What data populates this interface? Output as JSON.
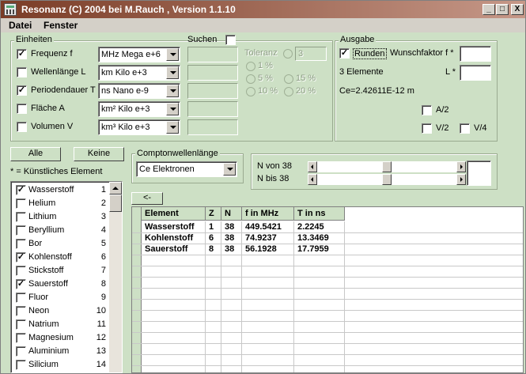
{
  "window": {
    "title": "Resonanz (C) 2004 bei M.Rauch , Version 1.1.10",
    "minimize": "_",
    "maximize": "□",
    "close": "X"
  },
  "menu": {
    "items": [
      "Datei",
      "Fenster"
    ]
  },
  "einheiten": {
    "label": "Einheiten",
    "rows": [
      {
        "checked": true,
        "label": "Frequenz f",
        "unit": "MHz Mega e+6"
      },
      {
        "checked": false,
        "label": "Wellenlänge L",
        "unit": "km Kilo e+3"
      },
      {
        "checked": true,
        "label": "Periodendauer T",
        "unit": "ns Nano e-9"
      },
      {
        "checked": false,
        "label": "Fläche A",
        "unit": "km² Kilo e+3"
      },
      {
        "checked": false,
        "label": "Volumen V",
        "unit": "km³ Kilo e+3"
      }
    ]
  },
  "suchen": {
    "label": "Suchen",
    "toleranz_label": "Toleranz",
    "toleranz_value": "3",
    "options": [
      "1 %",
      "5 %",
      "15 %",
      "10 %",
      "20 %"
    ]
  },
  "ausgabe": {
    "label": "Ausgabe",
    "runden_label": "Runden",
    "runden_checked": true,
    "wunschfaktor_f_label": "Wunschfaktor f *",
    "elemente": "3 Elemente",
    "l_label": "L *",
    "ce": "Ce=2.42611E-12 m",
    "a2": "A/2",
    "v2": "V/2",
    "v4": "V/4"
  },
  "buttons": {
    "alle": "Alle",
    "keine": "Keine",
    "back": "<-"
  },
  "note": "* = Künstliches Element",
  "compton": {
    "label": "Comptonwellenlänge",
    "value": "Ce Elektronen"
  },
  "range": {
    "von_label": "N von 38",
    "bis_label": "N bis 38"
  },
  "elements": [
    {
      "name": "Wasserstoff",
      "n": "1",
      "checked": true
    },
    {
      "name": "Helium",
      "n": "2",
      "checked": false
    },
    {
      "name": "Lithium",
      "n": "3",
      "checked": false
    },
    {
      "name": "Beryllium",
      "n": "4",
      "checked": false
    },
    {
      "name": "Bor",
      "n": "5",
      "checked": false
    },
    {
      "name": "Kohlenstoff",
      "n": "6",
      "checked": true
    },
    {
      "name": "Stickstoff",
      "n": "7",
      "checked": false
    },
    {
      "name": "Sauerstoff",
      "n": "8",
      "checked": true
    },
    {
      "name": "Fluor",
      "n": "9",
      "checked": false
    },
    {
      "name": "Neon",
      "n": "10",
      "checked": false
    },
    {
      "name": "Natrium",
      "n": "11",
      "checked": false
    },
    {
      "name": "Magnesium",
      "n": "12",
      "checked": false
    },
    {
      "name": "Aluminium",
      "n": "13",
      "checked": false
    },
    {
      "name": "Silicium",
      "n": "14",
      "checked": false
    }
  ],
  "table": {
    "headers": [
      "Element",
      "Z",
      "N",
      "f in MHz",
      "T in ns"
    ],
    "rows": [
      [
        "Wasserstoff",
        "1",
        "38",
        "449.5421",
        "2.2245"
      ],
      [
        "Kohlenstoff",
        "6",
        "38",
        "74.9237",
        "13.3469"
      ],
      [
        "Sauerstoff",
        "8",
        "38",
        "56.1928",
        "17.7959"
      ]
    ]
  }
}
